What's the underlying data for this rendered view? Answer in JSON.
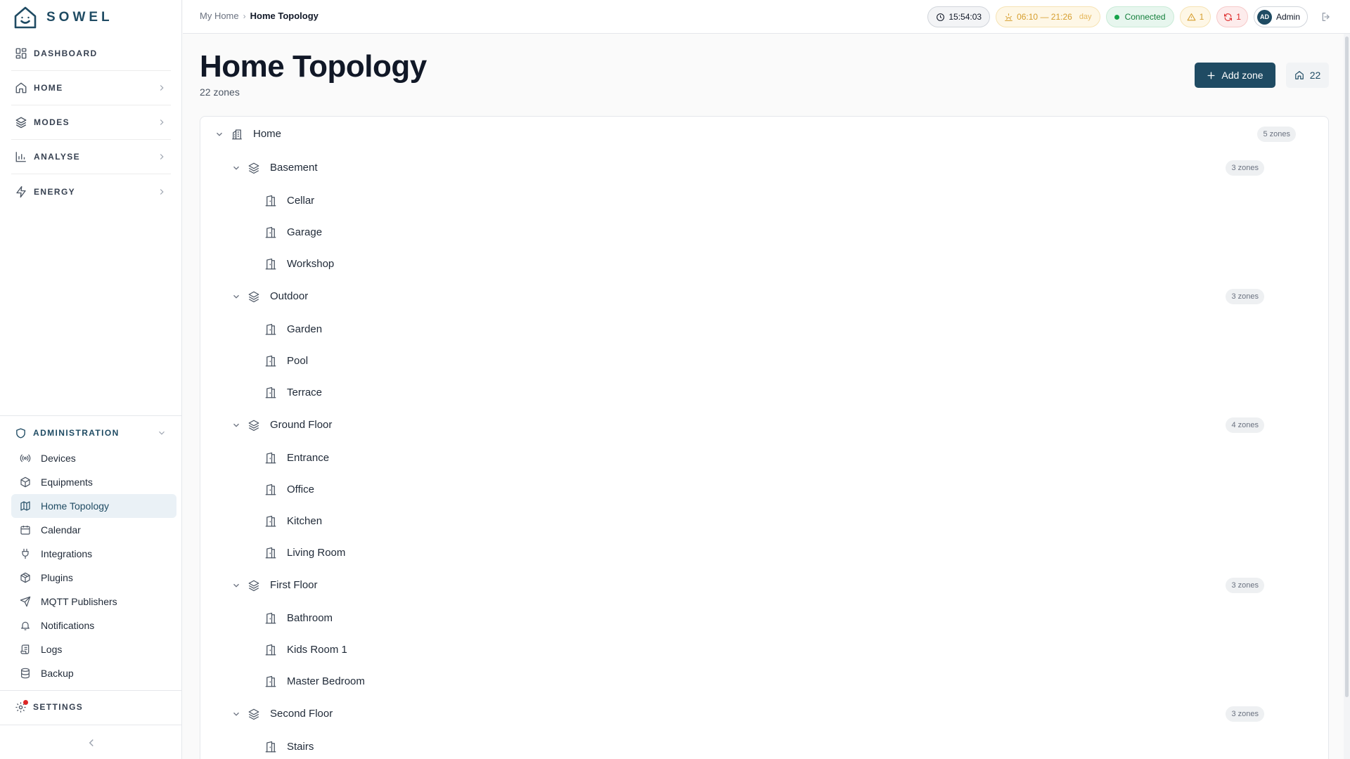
{
  "app": {
    "brand": "SOWEL"
  },
  "sidebar": {
    "main": [
      {
        "label": "DASHBOARD",
        "icon": "dashboard-icon",
        "has_chevron": false
      },
      {
        "label": "HOME",
        "icon": "home-icon",
        "has_chevron": true
      },
      {
        "label": "MODES",
        "icon": "layers-icon",
        "has_chevron": true
      },
      {
        "label": "ANALYSE",
        "icon": "chart-icon",
        "has_chevron": true
      },
      {
        "label": "ENERGY",
        "icon": "bolt-icon",
        "has_chevron": true
      }
    ],
    "admin": {
      "label": "ADMINISTRATION",
      "items": [
        {
          "label": "Devices",
          "icon": "radio-icon"
        },
        {
          "label": "Equipments",
          "icon": "cube-icon"
        },
        {
          "label": "Home Topology",
          "icon": "map-icon",
          "active": true
        },
        {
          "label": "Calendar",
          "icon": "calendar-icon"
        },
        {
          "label": "Integrations",
          "icon": "plug-icon"
        },
        {
          "label": "Plugins",
          "icon": "package-icon"
        },
        {
          "label": "MQTT Publishers",
          "icon": "send-icon"
        },
        {
          "label": "Notifications",
          "icon": "bell-icon"
        },
        {
          "label": "Logs",
          "icon": "scroll-icon"
        },
        {
          "label": "Backup",
          "icon": "database-icon"
        }
      ]
    },
    "settings_label": "SETTINGS"
  },
  "topbar": {
    "breadcrumb": {
      "parent": "My Home",
      "current": "Home Topology"
    },
    "time": "15:54:03",
    "sun": "06:10 — 21:26",
    "sun_period": "day",
    "connection": "Connected",
    "warnings": "1",
    "errors": "1",
    "user_initials": "AD",
    "user_name": "Admin"
  },
  "page": {
    "title": "Home Topology",
    "subtitle": "22 zones",
    "add_button": "Add zone",
    "zone_count": "22"
  },
  "tree": [
    {
      "name": "Home",
      "level": 0,
      "badge": "5 zones",
      "type": "building"
    },
    {
      "name": "Basement",
      "level": 1,
      "badge": "3 zones",
      "type": "floor"
    },
    {
      "name": "Cellar",
      "level": 2,
      "type": "room"
    },
    {
      "name": "Garage",
      "level": 2,
      "type": "room"
    },
    {
      "name": "Workshop",
      "level": 2,
      "type": "room"
    },
    {
      "name": "Outdoor",
      "level": 1,
      "badge": "3 zones",
      "type": "floor"
    },
    {
      "name": "Garden",
      "level": 2,
      "type": "room"
    },
    {
      "name": "Pool",
      "level": 2,
      "type": "room"
    },
    {
      "name": "Terrace",
      "level": 2,
      "type": "room"
    },
    {
      "name": "Ground Floor",
      "level": 1,
      "badge": "4 zones",
      "type": "floor"
    },
    {
      "name": "Entrance",
      "level": 2,
      "type": "room"
    },
    {
      "name": "Office",
      "level": 2,
      "type": "room"
    },
    {
      "name": "Kitchen",
      "level": 2,
      "type": "room"
    },
    {
      "name": "Living Room",
      "level": 2,
      "type": "room"
    },
    {
      "name": "First Floor",
      "level": 1,
      "badge": "3 zones",
      "type": "floor"
    },
    {
      "name": "Bathroom",
      "level": 2,
      "type": "room"
    },
    {
      "name": "Kids Room 1",
      "level": 2,
      "type": "room"
    },
    {
      "name": "Master Bedroom",
      "level": 2,
      "type": "room"
    },
    {
      "name": "Second Floor",
      "level": 1,
      "badge": "3 zones",
      "type": "floor"
    },
    {
      "name": "Stairs",
      "level": 2,
      "type": "room"
    }
  ]
}
